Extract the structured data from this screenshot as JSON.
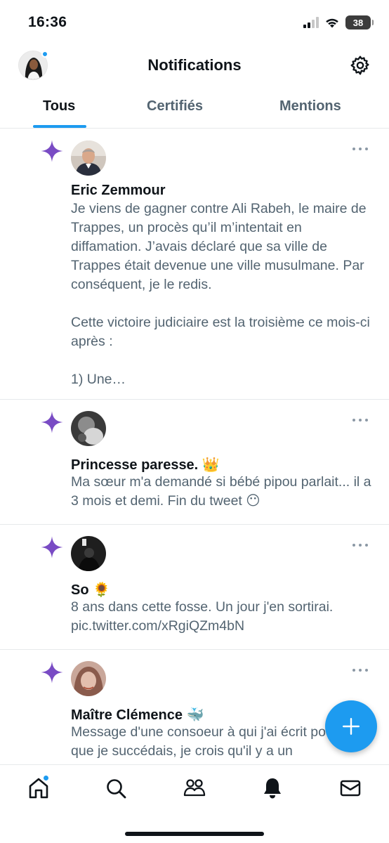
{
  "status_bar": {
    "time": "16:36",
    "battery": "38",
    "icons": [
      "cellular-signal-icon",
      "wifi-icon",
      "battery-icon"
    ]
  },
  "header": {
    "title": "Notifications",
    "avatar_icon": "profile-avatar",
    "settings_icon": "gear-icon"
  },
  "tabs": [
    {
      "label": "Tous",
      "active": true
    },
    {
      "label": "Certifiés",
      "active": false
    },
    {
      "label": "Mentions",
      "active": false
    }
  ],
  "notifications": [
    {
      "icon": "sparkle-icon",
      "name": "Eric Zemmour",
      "text": "Je viens de gagner contre Ali Rabeh, le maire de Trappes, un procès qu’il m’intentait en diffamation. J’avais déclaré que sa ville de Trappes était devenue une ville musulmane. Par conséquent, je le redis.\n\nCette victoire judiciaire est la troisième ce mois-ci après :\n\n1) Une…"
    },
    {
      "icon": "sparkle-icon",
      "name": "Princesse paresse. 👑",
      "text": "Ma sœur m'a demandé si bébé pipou parlait... il a 3 mois et demi. Fin du tweet 😶"
    },
    {
      "icon": "sparkle-icon",
      "name": "So 🌻",
      "text": "8 ans dans cette fosse. Un jour j'en sortirai. pic.twitter.com/xRgiQZm4bN"
    },
    {
      "icon": "sparkle-icon",
      "name": "Maître Clémence 🐳",
      "text": "Message d'une consoeur à qui j'ai écrit pour dire que je succédais, je crois qu'il y a un"
    }
  ],
  "fab": {
    "icon": "plus-icon"
  },
  "bottom_nav": [
    {
      "icon": "home-icon",
      "has_badge": true
    },
    {
      "icon": "search-icon"
    },
    {
      "icon": "communities-icon"
    },
    {
      "icon": "bell-icon",
      "active": true
    },
    {
      "icon": "mail-icon"
    }
  ],
  "colors": {
    "accent": "#1d9bf0",
    "sparkle": "#794bc4",
    "text_primary": "#0f1419",
    "text_secondary": "#536471"
  }
}
